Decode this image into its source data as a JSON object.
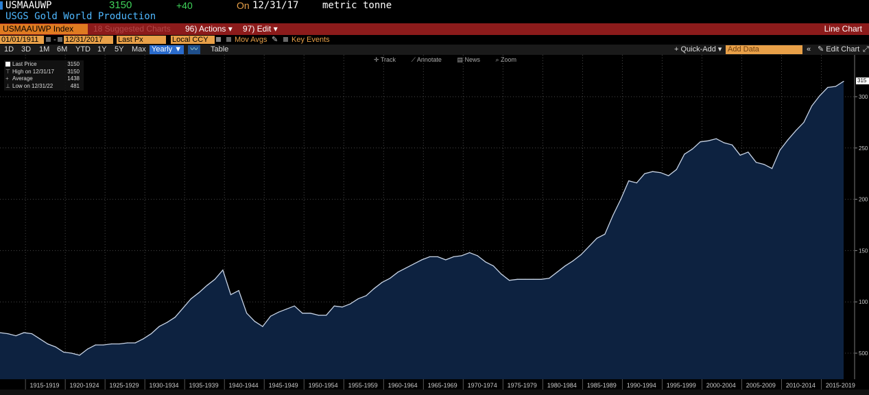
{
  "header": {
    "ticker": "USMAAUWP",
    "last": "3150",
    "change": "+40",
    "on_label": "On",
    "date": "12/31/17",
    "unit": "metric tonne",
    "title": "USGS Gold World Production"
  },
  "actionbar": {
    "index": "USMAAUWP Index",
    "suggested": "18 Suggested Charts",
    "actions": "96) Actions ▾",
    "edit": "97) Edit ▾",
    "chart_type": "Line Chart"
  },
  "options": {
    "start_date": "01/01/1911",
    "end_date": "12/31/2017",
    "dash": "-",
    "price_type": "Last Px",
    "currency": "Local CCY",
    "mov_avgs": "Mov Avgs",
    "key_events": "Key Events"
  },
  "toolbar": {
    "periods": [
      "1D",
      "3D",
      "1M",
      "6M",
      "YTD",
      "1Y",
      "5Y",
      "Max"
    ],
    "frequency": "Yearly ▼",
    "table": "Table",
    "quick_add": "+ Quick-Add ▾",
    "add_data_placeholder": "Add Data",
    "edit_chart": "Edit Chart"
  },
  "chart_tools": [
    "Track",
    "Annotate",
    "News",
    "Zoom"
  ],
  "legend": {
    "last_price_label": "Last Price",
    "last_price": "3150",
    "high_label": "High on 12/31/17",
    "high": "3150",
    "avg_label": "Average",
    "avg": "1438",
    "low_label": "Low on 12/31/22",
    "low": "481"
  },
  "colors": {
    "accent": "#e07b21",
    "bar": "#8c1b1b",
    "area": "#0d2240",
    "line": "#c8d4e6"
  },
  "chart_data": {
    "type": "area",
    "title": "USGS Gold World Production",
    "ylabel": "metric tonne",
    "ylim": [
      470,
      3300
    ],
    "y_ticks": [
      500,
      1000,
      1500,
      2000,
      2500,
      3000
    ],
    "y_tick_labels": [
      "500",
      "100",
      "150",
      "200",
      "250",
      "300"
    ],
    "last_value_label": "315",
    "x_labels": [
      "1915-1919",
      "1920-1924",
      "1925-1929",
      "1930-1934",
      "1935-1939",
      "1940-1944",
      "1945-1949",
      "1950-1954",
      "1955-1959",
      "1960-1964",
      "1965-1969",
      "1970-1974",
      "1975-1979",
      "1980-1984",
      "1985-1989",
      "1990-1994",
      "1995-1999",
      "2000-2004",
      "2005-2009",
      "2010-2014",
      "2015-2019"
    ],
    "x": [
      1911,
      1912,
      1913,
      1914,
      1915,
      1916,
      1917,
      1918,
      1919,
      1920,
      1921,
      1922,
      1923,
      1924,
      1925,
      1926,
      1927,
      1928,
      1929,
      1930,
      1931,
      1932,
      1933,
      1934,
      1935,
      1936,
      1937,
      1938,
      1939,
      1940,
      1941,
      1942,
      1943,
      1944,
      1945,
      1946,
      1947,
      1948,
      1949,
      1950,
      1951,
      1952,
      1953,
      1954,
      1955,
      1956,
      1957,
      1958,
      1959,
      1960,
      1961,
      1962,
      1963,
      1964,
      1965,
      1966,
      1967,
      1968,
      1969,
      1970,
      1971,
      1972,
      1973,
      1974,
      1975,
      1976,
      1977,
      1978,
      1979,
      1980,
      1981,
      1982,
      1983,
      1984,
      1985,
      1986,
      1987,
      1988,
      1989,
      1990,
      1991,
      1992,
      1993,
      1994,
      1995,
      1996,
      1997,
      1998,
      1999,
      2000,
      2001,
      2002,
      2003,
      2004,
      2005,
      2006,
      2007,
      2008,
      2009,
      2010,
      2011,
      2012,
      2013,
      2014,
      2015,
      2016,
      2017
    ],
    "series": [
      {
        "values": [
          700,
          690,
          670,
          700,
          690,
          640,
          590,
          560,
          510,
          500,
          480,
          540,
          580,
          580,
          590,
          590,
          600,
          600,
          640,
          690,
          760,
          800,
          850,
          940,
          1030,
          1090,
          1160,
          1220,
          1310,
          1070,
          1110,
          890,
          810,
          760,
          860,
          900,
          930,
          960,
          890,
          890,
          870,
          870,
          960,
          950,
          980,
          1030,
          1060,
          1130,
          1190,
          1230,
          1290,
          1330,
          1370,
          1410,
          1440,
          1440,
          1410,
          1440,
          1450,
          1480,
          1450,
          1390,
          1350,
          1270,
          1210,
          1220,
          1220,
          1220,
          1220,
          1230,
          1290,
          1350,
          1400,
          1460,
          1540,
          1620,
          1660,
          1840,
          2000,
          2180,
          2160,
          2250,
          2270,
          2260,
          2230,
          2290,
          2440,
          2490,
          2560,
          2570,
          2590,
          2550,
          2530,
          2430,
          2460,
          2360,
          2340,
          2300,
          2480,
          2580,
          2670,
          2750,
          2910,
          3010,
          3090,
          3100,
          3150
        ]
      }
    ]
  }
}
